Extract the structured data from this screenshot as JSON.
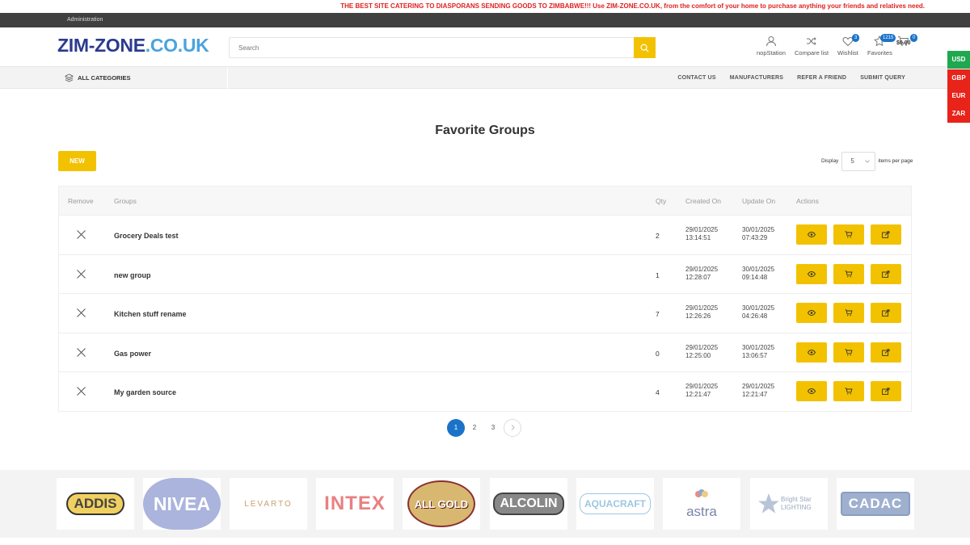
{
  "promo_text": "THE BEST SITE CATERING TO DIASPORANS SENDING GOODS TO ZIMBABWE!!! Use ZIM-ZONE.CO.UK, from the comfort of your home to purchase anything your friends and relatives need.",
  "admin_link": "Administration",
  "logo": {
    "part1": "ZIM-ZONE",
    "part2": ".CO.UK"
  },
  "search": {
    "placeholder": "Search"
  },
  "header_links": {
    "account": "nopStation",
    "compare": "Compare list",
    "wishlist": "Wishlist",
    "wishlist_count": "3",
    "favorites": "Favorites",
    "favorites_count": "1215",
    "cart_count": "0",
    "cart_total": "$0.00"
  },
  "nav": {
    "all_categories": "ALL CATEGORIES",
    "links": [
      "CONTACT US",
      "MANUFACTURERS",
      "REFER A FRIEND",
      "SUBMIT QUERY"
    ]
  },
  "currencies": [
    {
      "code": "USD",
      "color": "#1fa84f"
    },
    {
      "code": "GBP",
      "color": "#e8231a"
    },
    {
      "code": "EUR",
      "color": "#e8231a"
    },
    {
      "code": "ZAR",
      "color": "#e8231a"
    }
  ],
  "page_title": "Favorite Groups",
  "new_button": "NEW",
  "display": {
    "label": "Display",
    "value": "5",
    "suffix": "items per page"
  },
  "table": {
    "headers": {
      "remove": "Remove",
      "groups": "Groups",
      "qty": "Qty",
      "created": "Created On",
      "updated": "Update On",
      "actions": "Actions"
    },
    "rows": [
      {
        "name": "Grocery Deals test",
        "qty": "2",
        "created_date": "29/01/2025",
        "created_time": "13:14:51",
        "updated_date": "30/01/2025",
        "updated_time": "07:43:29"
      },
      {
        "name": "new group",
        "qty": "1",
        "created_date": "29/01/2025",
        "created_time": "12:28:07",
        "updated_date": "30/01/2025",
        "updated_time": "09:14:48"
      },
      {
        "name": "Kitchen stuff rename",
        "qty": "7",
        "created_date": "29/01/2025",
        "created_time": "12:26:26",
        "updated_date": "30/01/2025",
        "updated_time": "04:26:48"
      },
      {
        "name": "Gas power",
        "qty": "0",
        "created_date": "29/01/2025",
        "created_time": "12:25:00",
        "updated_date": "30/01/2025",
        "updated_time": "13:06:57"
      },
      {
        "name": "My garden source",
        "qty": "4",
        "created_date": "29/01/2025",
        "created_time": "12:21:47",
        "updated_date": "29/01/2025",
        "updated_time": "12:21:47"
      }
    ]
  },
  "pagination": {
    "pages": [
      "1",
      "2",
      "3"
    ],
    "current": "1"
  },
  "brands": [
    "ADDIS",
    "NIVEA",
    "LEVARTO",
    "INTEX",
    "ALL GOLD",
    "ALCOLIN",
    "AQUACRAFT",
    "astra",
    "Bright Star LIGHTING",
    "CADAC"
  ],
  "colors": {
    "accent": "#f2c200",
    "primary": "#1a73c8",
    "logo_dark": "#2b3a8f",
    "logo_light": "#4aa3df"
  }
}
